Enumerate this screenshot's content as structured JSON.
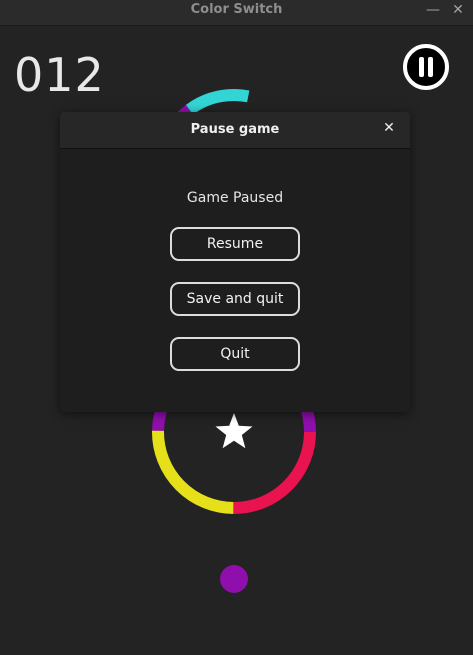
{
  "window": {
    "title": "Color Switch",
    "minimize_icon": "minimize-icon",
    "close_icon": "close-icon"
  },
  "hud": {
    "score": "012",
    "pause_icon": "pause-icon"
  },
  "colors": {
    "purple": "#8f0fad",
    "cyan": "#33d4d4",
    "pink": "#e8134f",
    "yellow": "#e5e01a",
    "background": "#232323",
    "star": "#ffffff"
  },
  "scene": {
    "ring_segments_top": [
      "purple",
      "cyan"
    ],
    "ring_segments_bottom": [
      "purple",
      "pink",
      "yellow"
    ],
    "star_icon": "star-icon",
    "player_ball_color": "purple"
  },
  "dialog": {
    "title": "Pause game",
    "close_icon": "close-icon",
    "message": "Game Paused",
    "buttons": {
      "resume": "Resume",
      "save_and_quit": "Save and quit",
      "quit": "Quit"
    }
  }
}
